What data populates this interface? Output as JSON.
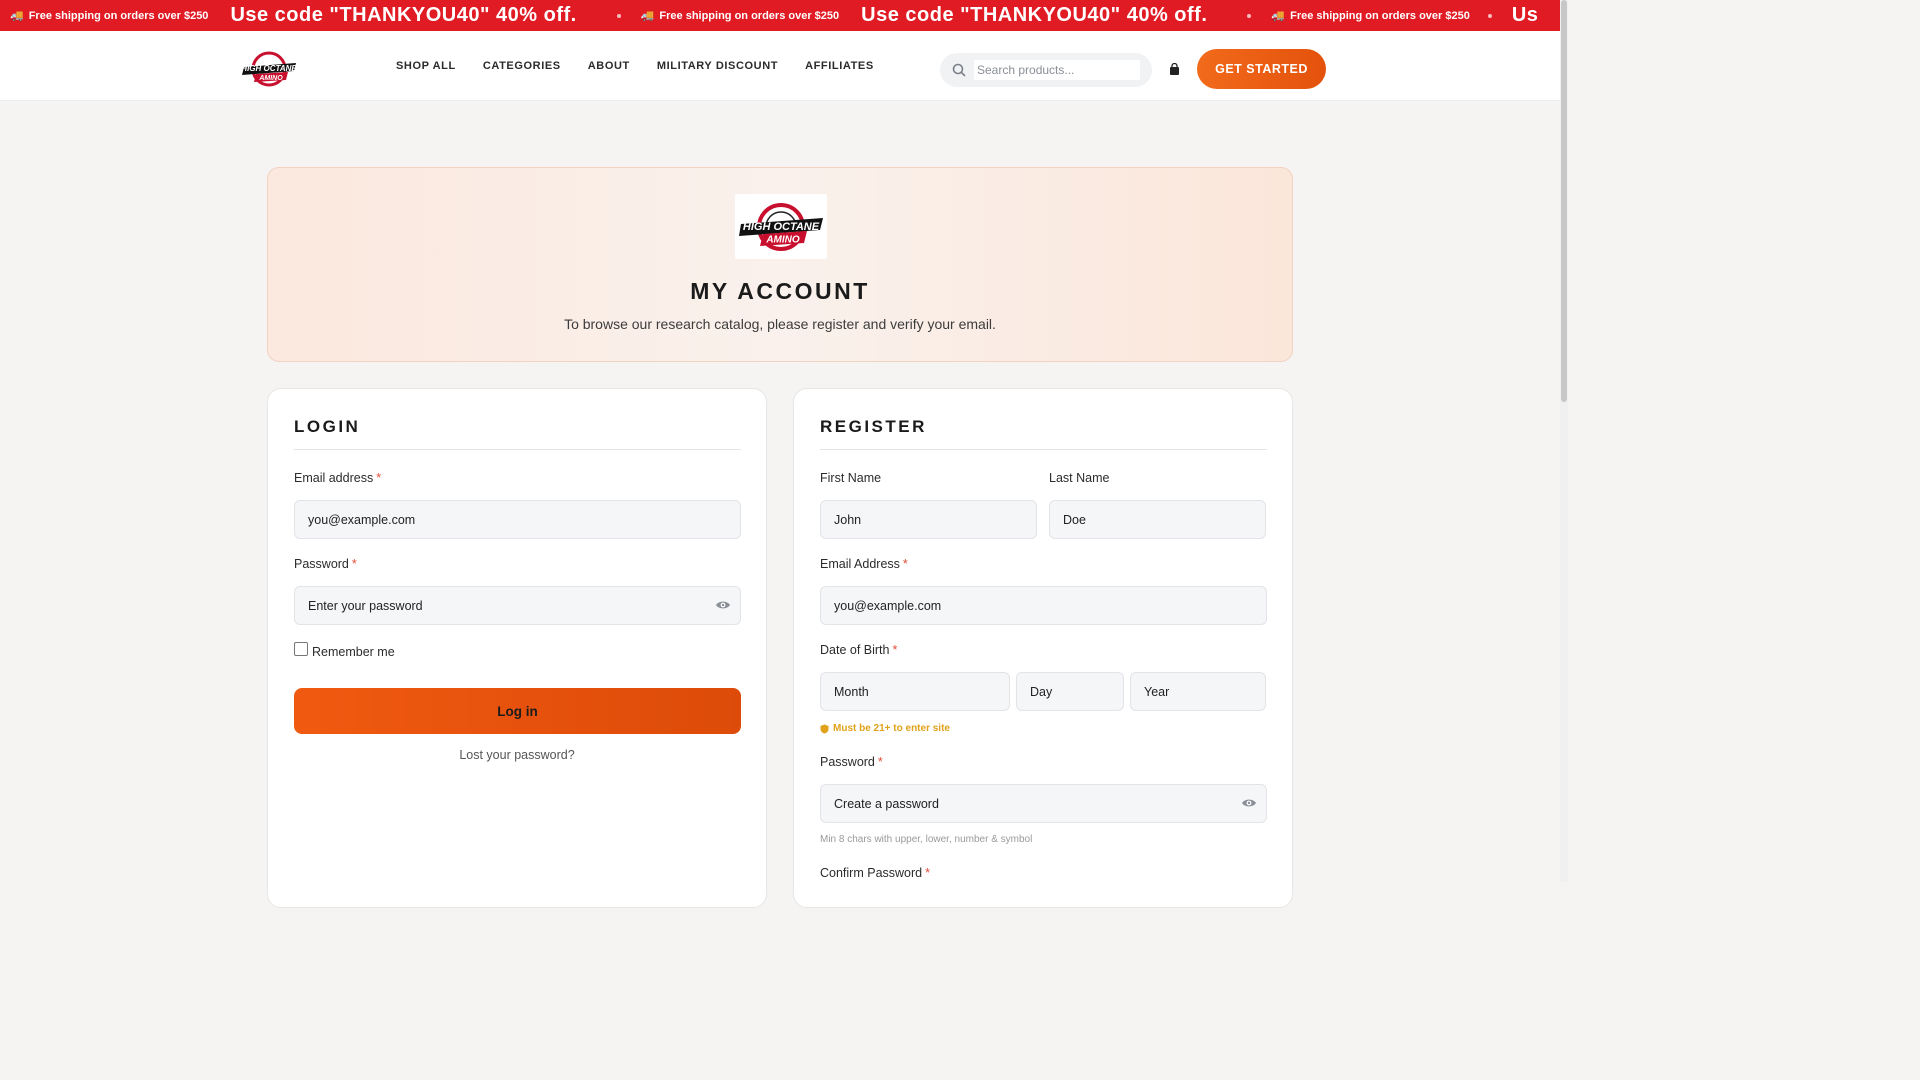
{
  "promo": {
    "shipping_text": "Free shipping on orders over $250",
    "code_text": "Use code \"THANKYOU40\" 40% off.",
    "code_text_cut": "Us"
  },
  "header": {
    "logo_alt": "High Octane Amino",
    "nav": [
      "SHOP ALL",
      "CATEGORIES",
      "ABOUT",
      "MILITARY DISCOUNT",
      "AFFILIATES"
    ],
    "search_placeholder": "Search products...",
    "cta_label": "GET STARTED"
  },
  "hero": {
    "title": "MY ACCOUNT",
    "subtitle": "To browse our research catalog, please register and verify your email."
  },
  "login": {
    "title": "LOGIN",
    "email_label": "Email address",
    "email_placeholder": "you@example.com",
    "password_label": "Password",
    "password_placeholder": "Enter your password",
    "remember_label": "Remember me",
    "submit_label": "Log in",
    "lost_password": "Lost your password?"
  },
  "register": {
    "title": "REGISTER",
    "first_name_label": "First Name",
    "first_name_placeholder": "John",
    "last_name_label": "Last Name",
    "last_name_placeholder": "Doe",
    "email_label": "Email Address",
    "email_placeholder": "you@example.com",
    "dob_label": "Date of Birth",
    "dob_month": "Month",
    "dob_day": "Day",
    "dob_year": "Year",
    "age_note": "Must be 21+ to enter site",
    "password_label": "Password",
    "password_placeholder": "Create a password",
    "password_hint": "Min 8 chars with upper, lower, number & symbol",
    "confirm_label": "Confirm Password"
  },
  "required_mark": "*",
  "colors": {
    "promo_bg": "#e01b24",
    "accent": "#f05a10",
    "warning": "#e0a21a"
  }
}
